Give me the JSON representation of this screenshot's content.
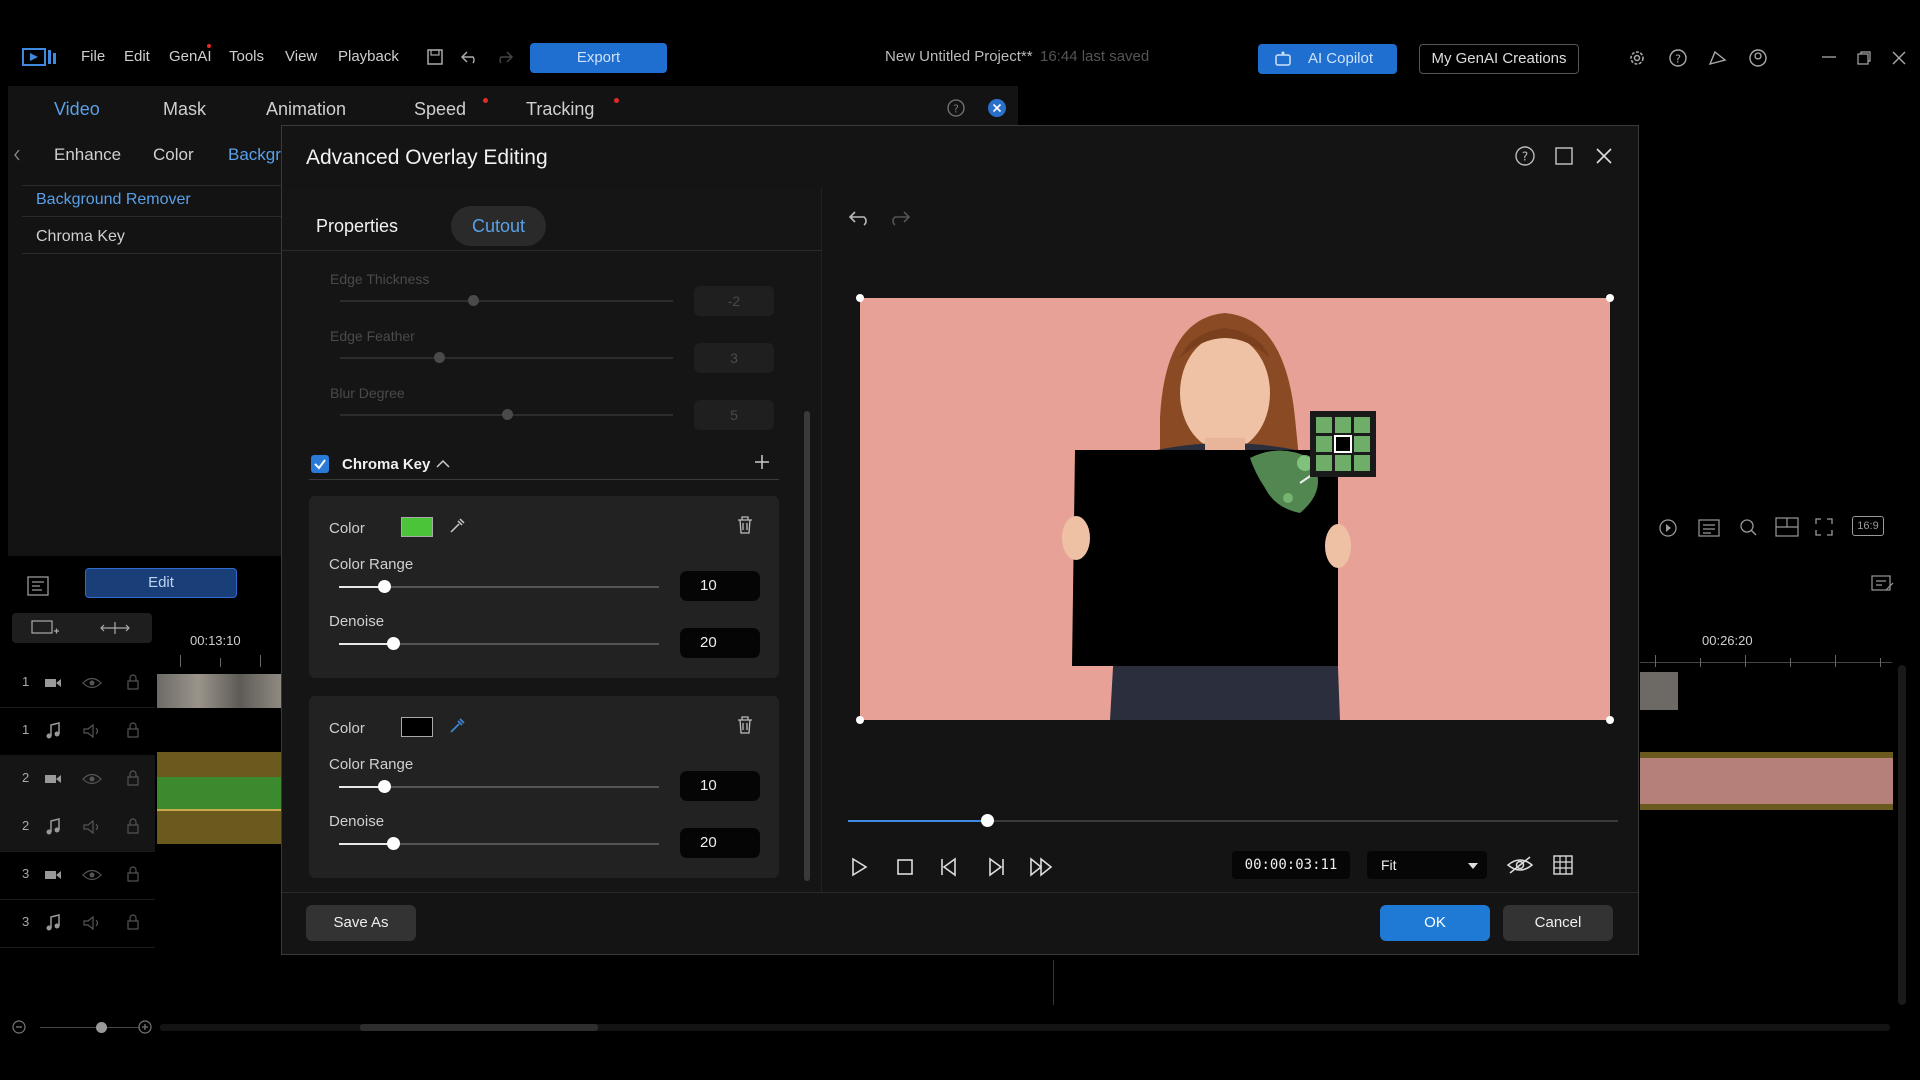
{
  "menu": {
    "file": "File",
    "edit": "Edit",
    "genai": "GenAI",
    "tools": "Tools",
    "view": "View",
    "playback": "Playback",
    "export": "Export"
  },
  "project": {
    "title": "New Untitled Project**",
    "saved": "16:44 last saved"
  },
  "right_buttons": {
    "copilot": "AI Copilot",
    "creations": "My GenAI Creations"
  },
  "app_tabs": {
    "video": "Video",
    "mask": "Mask",
    "animation": "Animation",
    "speed": "Speed",
    "tracking": "Tracking"
  },
  "sub_tabs": {
    "enhance": "Enhance",
    "color": "Color",
    "background": "Backgr"
  },
  "side_items": {
    "bg_remover": "Background Remover",
    "chroma_key": "Chroma Key"
  },
  "timeline": {
    "edit_label": "Edit",
    "time_left": "00:13:10",
    "time_right": "00:26:20",
    "tracks": [
      "1",
      "1",
      "2",
      "2",
      "3",
      "3"
    ],
    "aspect": "16:9"
  },
  "dialog": {
    "title": "Advanced Overlay Editing",
    "tabs": {
      "properties": "Properties",
      "cutout": "Cutout"
    },
    "faded": [
      {
        "label": "Edge Thickness",
        "value": "-2"
      },
      {
        "label": "Edge Feather",
        "value": "3"
      },
      {
        "label": "Blur Degree",
        "value": "5"
      }
    ],
    "chroma_key_label": "Chroma Key",
    "keys": [
      {
        "color_label": "Color",
        "swatch": "#4cc43a",
        "range_label": "Color Range",
        "range_value": "10",
        "range_level": 0.14,
        "denoise_label": "Denoise",
        "denoise_value": "20",
        "denoise_level": 0.17
      },
      {
        "color_label": "Color",
        "swatch": "#000000",
        "range_label": "Color Range",
        "range_value": "10",
        "range_level": 0.14,
        "denoise_label": "Denoise",
        "denoise_value": "20",
        "denoise_level": 0.17
      }
    ],
    "timecode": "00:00:03:11",
    "fit": "Fit",
    "playhead_level": 0.18,
    "save_as": "Save As",
    "ok": "OK",
    "cancel": "Cancel"
  },
  "colors": {
    "accent": "#1f7ad6",
    "accent_text": "#5aa0e8",
    "bg": "#000000",
    "panel": "#151515"
  }
}
